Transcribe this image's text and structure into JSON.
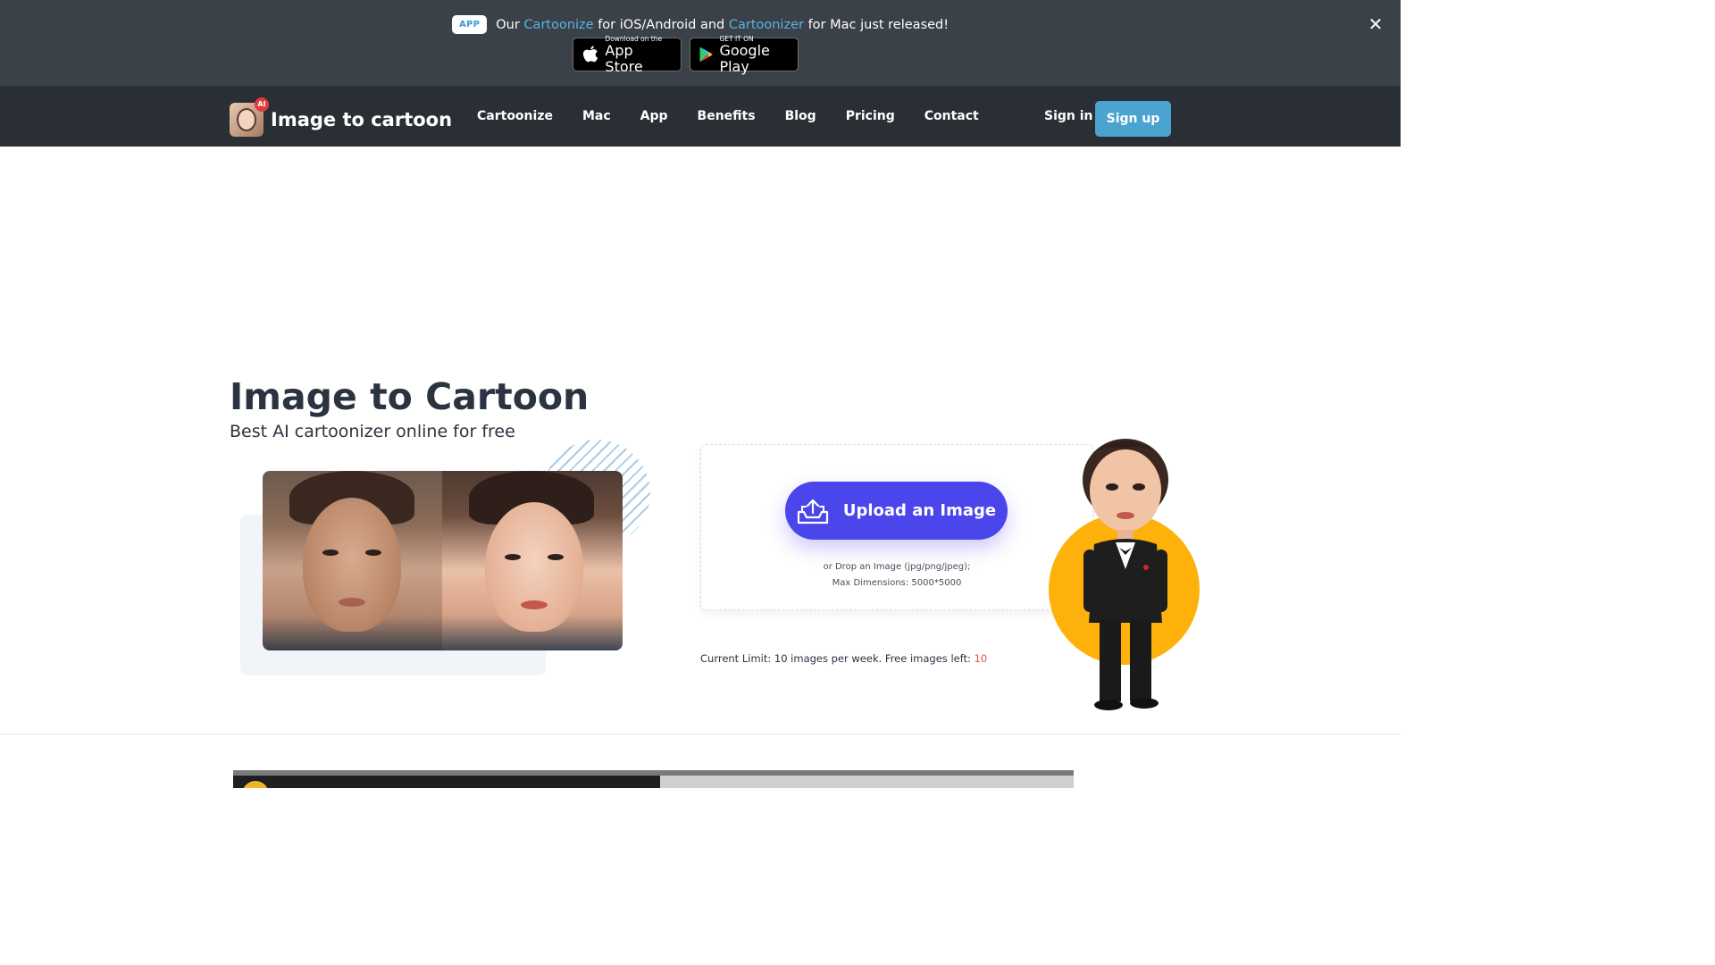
{
  "announcement": {
    "badge": "APP",
    "text_prefix": "Our ",
    "link1": "Cartoonize",
    "text_mid": " for iOS/Android and ",
    "link2": "Cartoonizer",
    "text_suffix": " for Mac just released!",
    "app_store_small": "Download on the",
    "app_store_big": "App Store",
    "google_small": "GET IT ON",
    "google_big": "Google Play",
    "close_icon": "close-icon"
  },
  "nav": {
    "brand": "Image to cartoon",
    "brand_badge": "AI",
    "links": [
      "Cartoonize",
      "Mac",
      "App",
      "Benefits",
      "Blog",
      "Pricing",
      "Contact"
    ],
    "sign_in": "Sign in",
    "sign_up": "Sign up"
  },
  "hero": {
    "title": "Image to Cartoon",
    "subtitle": "Best AI cartoonizer online for free"
  },
  "upload": {
    "button_label": "Upload an Image",
    "drop_line1": "or Drop an Image (jpg/png/jpeg);",
    "drop_line2": "Max Dimensions: 5000*5000",
    "limit_text": "Current Limit: 10 images per week. Free images left: ",
    "limit_left": "10"
  },
  "colors": {
    "accent": "#4b45ec",
    "signup": "#4aa4cf",
    "announce_bg": "#3b4149",
    "nav_bg": "#2a2f36",
    "mascot_circle": "#fdb10a"
  }
}
